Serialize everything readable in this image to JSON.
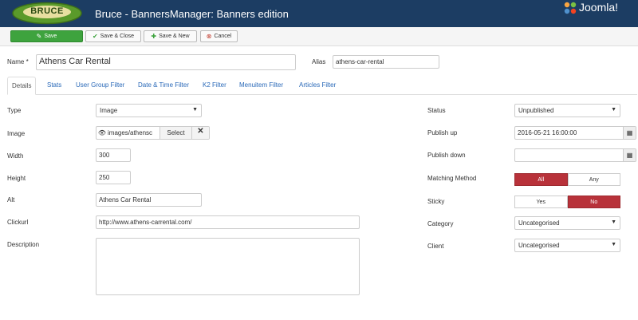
{
  "header": {
    "logo_text": "BRUCE",
    "title": "Bruce - BannersManager: Banners edition",
    "brand": "Joomla!"
  },
  "toolbar": {
    "save": "Save",
    "save_close": "Save & Close",
    "save_new": "Save & New",
    "cancel": "Cancel"
  },
  "form": {
    "name_label": "Name *",
    "name_value": "Athens Car Rental",
    "alias_label": "Alias",
    "alias_value": "athens-car-rental"
  },
  "tabs": [
    "Details",
    "Stats",
    "User Group Filter",
    "Date & Time Filter",
    "K2 Filter",
    "Menuitem Filter",
    "Articles Filter"
  ],
  "details": {
    "type_label": "Type",
    "type_value": "Image",
    "image_label": "Image",
    "image_value": "images/athensc",
    "image_select": "Select",
    "width_label": "Width",
    "width_value": "300",
    "height_label": "Height",
    "height_value": "250",
    "alt_label": "Alt",
    "alt_value": "Athens Car Rental",
    "clickurl_label": "Clickurl",
    "clickurl_value": "http://www.athens-carrental.com/",
    "description_label": "Description",
    "description_value": ""
  },
  "side": {
    "status_label": "Status",
    "status_value": "Unpublished",
    "publish_up_label": "Publish up",
    "publish_up_value": "2016-05-21 16:00:00",
    "publish_down_label": "Publish down",
    "publish_down_value": "",
    "matching_label": "Matching Method",
    "matching_options": [
      "All",
      "Any"
    ],
    "sticky_label": "Sticky",
    "sticky_options": [
      "Yes",
      "No"
    ],
    "category_label": "Category",
    "category_value": "Uncategorised",
    "client_label": "Client",
    "client_value": "Uncategorised"
  },
  "colors": {
    "header": "#1c3d63",
    "save_button": "#3ea33e",
    "active_toggle": "#b8323a",
    "link": "#2a69b8"
  }
}
